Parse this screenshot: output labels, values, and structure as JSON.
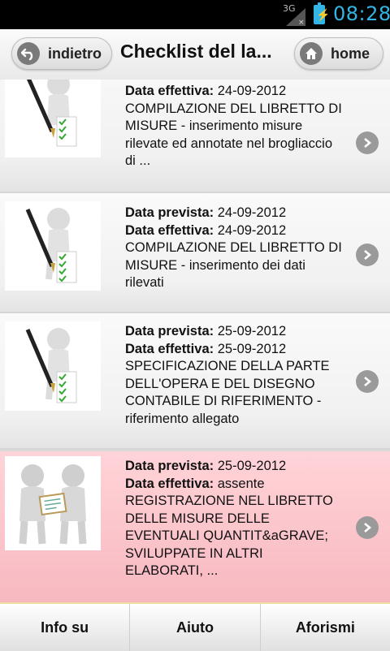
{
  "status": {
    "network": "3G",
    "time": "08:28"
  },
  "header": {
    "back_label": "indietro",
    "title": "Checklist del la...",
    "home_label": "home"
  },
  "items": [
    {
      "prev_label": "",
      "prev_value": "",
      "eff_label": "Data effettiva:",
      "eff_value": "24-09-2012",
      "desc": "COMPILAZIONE DEL LIBRETTO DI MISURE - inserimento misure rilevate ed annotate nel brogliaccio di ...",
      "icon": "pen-checklist"
    },
    {
      "prev_label": "Data prevista:",
      "prev_value": "24-09-2012",
      "eff_label": "Data effettiva:",
      "eff_value": "24-09-2012",
      "desc": "COMPILAZIONE DEL LIBRETTO DI MISURE - inserimento dei dati rilevati",
      "icon": "pen-checklist"
    },
    {
      "prev_label": "Data prevista:",
      "prev_value": "25-09-2012",
      "eff_label": "Data effettiva:",
      "eff_value": "25-09-2012",
      "desc": "SPECIFICAZIONE DELLA PARTE DELL'OPERA E DEL DISEGNO CONTABILE DI RIFERIMENTO - riferimento allegato",
      "icon": "pen-checklist"
    },
    {
      "prev_label": "Data prevista:",
      "prev_value": "25-09-2012",
      "eff_label": "Data effettiva:",
      "eff_value": "assente",
      "desc": "REGISTRAZIONE NEL LIBRETTO DELLE MISURE DELLE EVENTUALI QUANTIT&aGRAVE; SVILUPPATE IN ALTRI ELABORATI, ...",
      "icon": "people-document"
    }
  ],
  "footer": {
    "tabs": [
      "Info su",
      "Aiuto",
      "Aforismi"
    ]
  },
  "colors": {
    "highlight": "#f7b8c0",
    "time": "#33b5e5"
  }
}
